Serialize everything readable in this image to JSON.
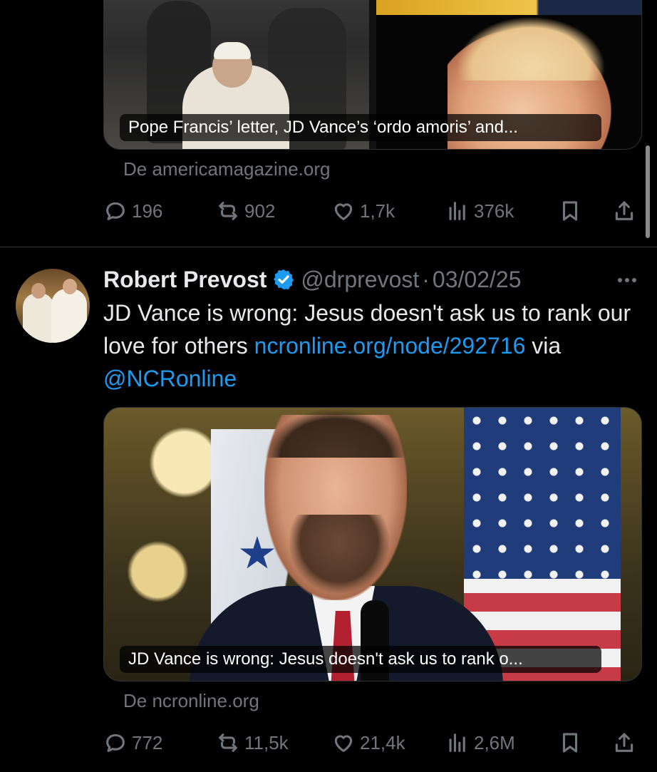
{
  "previous_tweet": {
    "card_caption": "Pope Francis’ letter, JD Vance’s ‘ordo amoris’ and...",
    "source": "De americamagazine.org",
    "metrics": {
      "replies": "196",
      "reposts": "902",
      "likes": "1,7k",
      "views": "376k"
    }
  },
  "tweet": {
    "display_name": "Robert Prevost",
    "verified": true,
    "handle": "@drprevost",
    "separator": "·",
    "date": "03/02/25",
    "text_plain_1": "JD Vance is wrong: Jesus doesn't ask us to rank our love for others ",
    "link_1": "ncronline.org/node/292716",
    "text_plain_2": " via ",
    "link_2": "@NCRonline",
    "card_caption": "JD Vance is wrong: Jesus doesn't ask us to rank o...",
    "source": "De ncronline.org",
    "metrics": {
      "replies": "772",
      "reposts": "11,5k",
      "likes": "21,4k",
      "views": "2,6M"
    }
  },
  "icons": {
    "reply": "reply-icon",
    "repost": "repost-icon",
    "like": "heart-icon",
    "views": "views-icon",
    "bookmark": "bookmark-icon",
    "share": "share-icon",
    "more": "more-icon",
    "verified": "verified-badge-icon"
  },
  "colors": {
    "background": "#000000",
    "text": "#e7e9ea",
    "muted": "#71767b",
    "link": "#1d9bf0",
    "divider": "#2f3336"
  }
}
